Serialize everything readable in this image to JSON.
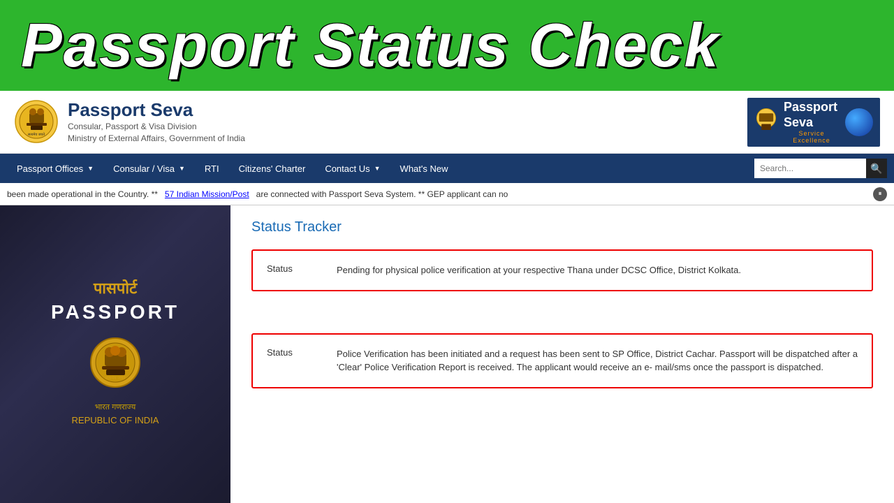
{
  "top_banner": {
    "title": "Passport Status Check"
  },
  "header": {
    "site_name": "Passport Seva",
    "tagline_line1": "Consular, Passport & Visa Division",
    "tagline_line2": "Ministry of External Affairs, Government of India",
    "badge_line1": "Passport",
    "badge_line2": "Seva",
    "badge_sub": "Service Excellence"
  },
  "navbar": {
    "items": [
      {
        "label": "Passport Offices",
        "has_dropdown": true
      },
      {
        "label": "Consular / Visa",
        "has_dropdown": true
      },
      {
        "label": "RTI",
        "has_dropdown": false
      },
      {
        "label": "Citizens' Charter",
        "has_dropdown": false
      },
      {
        "label": "Contact Us",
        "has_dropdown": true
      },
      {
        "label": "What's New",
        "has_dropdown": false
      }
    ],
    "search_placeholder": "Search..."
  },
  "ticker": {
    "text_before": "been made operational in the Country. **",
    "link_text": "57 Indian Mission/Post",
    "text_after": "are connected with Passport Seva System. ** GEP applicant can no"
  },
  "status_tracker": {
    "title": "Status Tracker",
    "status_label": "Status",
    "box1": {
      "value": "Pending for physical police verification at your respective Thana under DCSC Office, District Kolkata."
    },
    "box2": {
      "value": "Police Verification has been initiated and a request has been sent to SP Office, District Cachar. Passport will be dispatched after a 'Clear' Police Verification Report is received. The applicant would receive an e- mail/sms once the passport is dispatched."
    }
  },
  "passport_book": {
    "hindi_text": "पासपोर्ट",
    "english_text": "PASSPORT",
    "footer_hindi": "भारत गणराज्य",
    "footer_english": "REPUBLIC OF INDIA"
  }
}
